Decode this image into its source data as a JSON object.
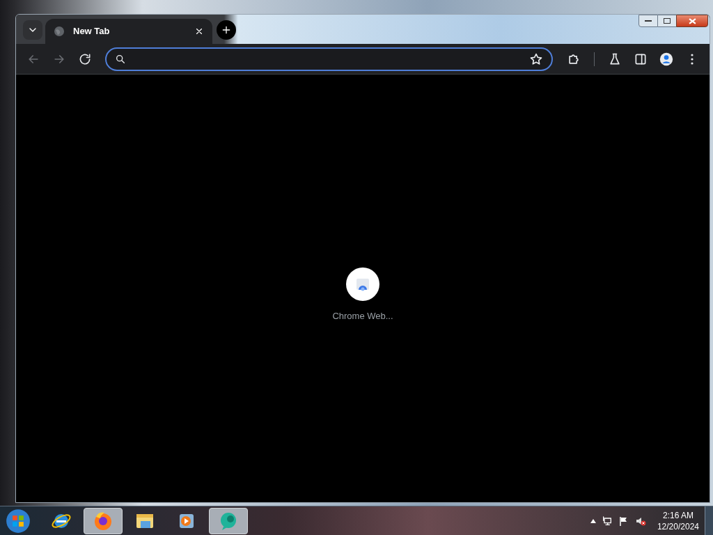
{
  "browser": {
    "tabs": [
      {
        "title": "New Tab",
        "selected": true
      }
    ],
    "toolbar": {
      "back_disabled": true,
      "forward_disabled": true
    },
    "shortcuts": [
      {
        "label": "Chrome Web..."
      }
    ]
  },
  "taskbar": {
    "apps": [
      {
        "kind": "ie",
        "selected": false
      },
      {
        "kind": "firefox",
        "selected": true
      },
      {
        "kind": "folder",
        "selected": false
      },
      {
        "kind": "media",
        "selected": false
      },
      {
        "kind": "chat",
        "selected": true
      }
    ],
    "time": "2:16 AM",
    "date": "12/20/2024"
  }
}
